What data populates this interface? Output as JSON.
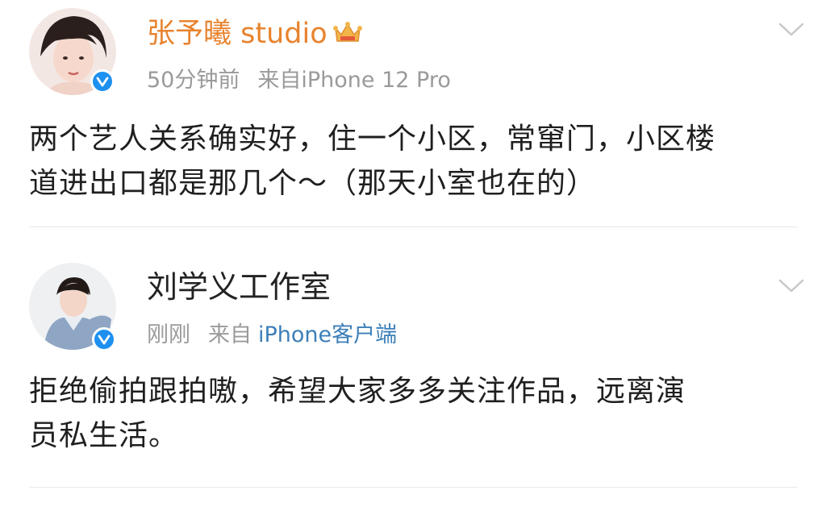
{
  "posts": [
    {
      "author": "张予曦 studio",
      "time": "50分钟前",
      "source_prefix": "来自",
      "source_client": "iPhone 12 Pro",
      "content_line1": "两个艺人关系确实好，住一个小区，常窜门，小区楼",
      "content_line2": "道进出口都是那几个～（那天小室也在的）",
      "name_color": "#e8832e",
      "badge_icon": "crown-icon"
    },
    {
      "author": "刘学义工作室",
      "time": "刚刚",
      "source_prefix": "来自",
      "source_client": "iPhone客户端",
      "content_line1": "拒绝偷拍跟拍嗷，希望大家多多关注作品，远离演",
      "content_line2": "员私生活。",
      "client_link_color": "#3d7fb8"
    }
  ],
  "verified_color": "#1e90f0"
}
